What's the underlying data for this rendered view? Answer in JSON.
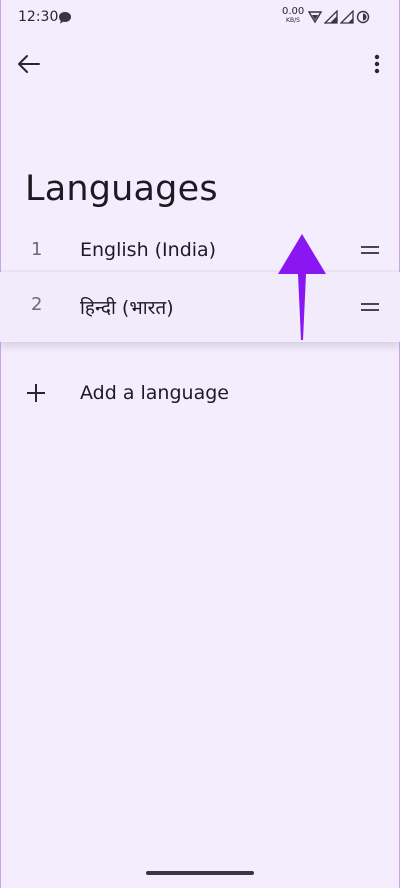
{
  "status_bar": {
    "time": "12:30",
    "net_speed_value": "0.00",
    "net_speed_unit": "KB/S"
  },
  "page": {
    "title": "Languages"
  },
  "languages": [
    {
      "index": "1",
      "label": "English (India)"
    },
    {
      "index": "2",
      "label": "हिन्दी (भारत)"
    }
  ],
  "add_language": {
    "label": "Add a language"
  },
  "colors": {
    "background": "#f3edfd",
    "annotation_arrow": "#8a16f2"
  },
  "icons": {
    "back": "arrow-left-icon",
    "more": "more-vert-icon",
    "drag": "drag-handle-icon",
    "add": "plus-icon"
  }
}
